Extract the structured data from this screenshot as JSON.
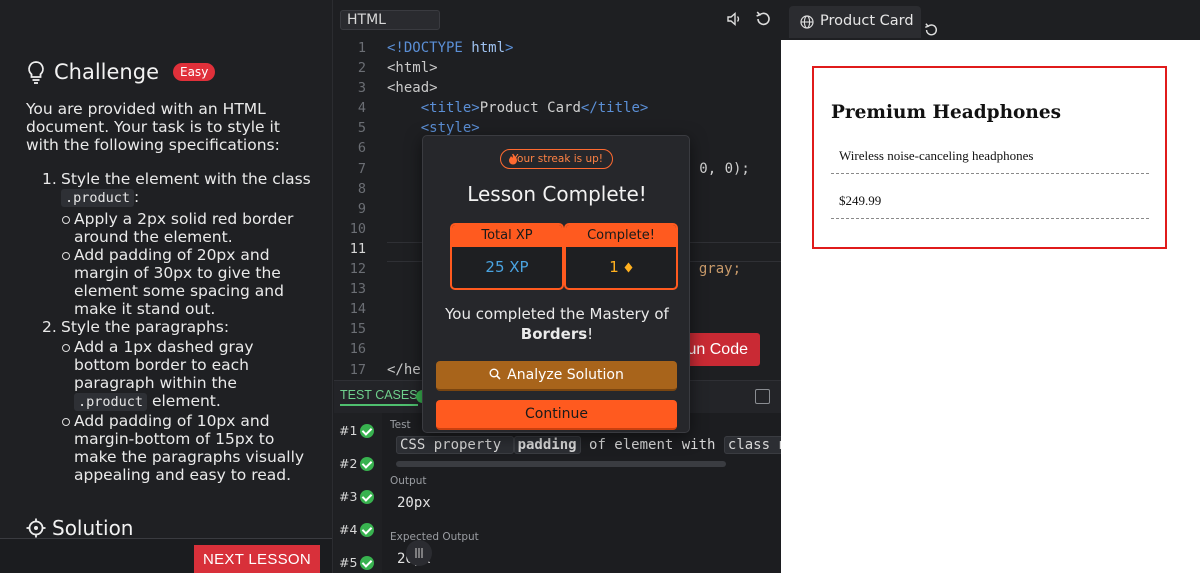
{
  "challenge": {
    "title": "Challenge",
    "badge": "Easy",
    "description": "You are provided with an HTML document. Your task is to style it with the following specifications:",
    "steps": [
      {
        "num": "1.",
        "text_before": "Style the element with the class",
        "code": ".product",
        "text_after": ":",
        "subs": [
          {
            "text": "Apply a 2px solid red border around the element."
          },
          {
            "text": "Add padding of 20px and margin of 30px to give the element some spacing and make it stand out."
          }
        ]
      },
      {
        "num": "2.",
        "text_before": "Style the paragraphs:",
        "subs": [
          {
            "text_before": "Add a 1px dashed gray bottom border to each paragraph within the",
            "code": ".product",
            "text_after": "element."
          },
          {
            "text": "Add padding of 10px and margin-bottom of 15px to make the paragraphs visually appealing and easy to read."
          }
        ]
      }
    ],
    "solution_title": "Solution",
    "next_button": "NEXT LESSON"
  },
  "editor": {
    "language_tab": "HTML",
    "line_numbers": [
      "1",
      "2",
      "3",
      "4",
      "5",
      "6",
      "7",
      "8",
      "9",
      "10",
      "11",
      "12",
      "13",
      "14",
      "15",
      "16",
      "17"
    ],
    "active_line": "11",
    "visible_code": {
      "l1_a": "<!DOCTYPE ",
      "l1_b": "html",
      "l1_c": ">",
      "l2": "<html>",
      "l3": "<head>",
      "l4_a": "<title>",
      "l4_b": "Product Card",
      "l4_c": "</title>",
      "l5": "<style>",
      "l7": "5, 0, 0);",
      "l12": "d gray;",
      "l17": "</he"
    },
    "run_button": "un Code"
  },
  "tests": {
    "tab_label": "TEST CASES",
    "cases": [
      "#1",
      "#2",
      "#3",
      "#4",
      "#5"
    ],
    "test_label": "Test",
    "test_desc": {
      "pre": "CSS property ",
      "prop": "padding",
      "mid": " of element with ",
      "tail": "class na"
    },
    "output_label": "Output",
    "output_value": "20px",
    "expected_label": "Expected Output",
    "expected_value": "20px"
  },
  "preview": {
    "tab_title": "Product Card",
    "card_title": "Premium Headphones",
    "paragraph_1": "Wireless noise-canceling headphones",
    "paragraph_2": "$249.99"
  },
  "modal": {
    "streak": "Your streak is up!",
    "title": "Lesson Complete!",
    "xp_label": "Total XP",
    "xp_value": "25 XP",
    "complete_label": "Complete!",
    "complete_value": "1",
    "message_line1": "You completed the Mastery of",
    "message_bold": "Borders",
    "message_end": "!",
    "analyze_button": "Analyze Solution",
    "continue_button": "Continue"
  },
  "colors": {
    "accent_orange": "#ff5a1f",
    "badge_red": "#e0303a",
    "success_green": "#38b24f",
    "xp_blue": "#4aa3e0",
    "border_red": "#e01b1b"
  },
  "icons": [
    "lightbulb-icon",
    "target-icon",
    "speaker-icon",
    "reset-icon",
    "globe-icon",
    "flame-icon",
    "diamond-icon",
    "magnifier-icon",
    "check-icon",
    "collapse-icon",
    "grip-icon"
  ]
}
